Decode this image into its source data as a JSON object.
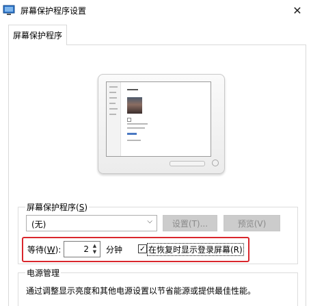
{
  "window": {
    "title": "屏幕保护程序设置",
    "close_glyph": "✕"
  },
  "tabs": [
    {
      "label": "屏幕保护程序"
    }
  ],
  "screen_saver": {
    "group_label_prefix": "屏幕保护程序(",
    "group_label_key": "S",
    "group_label_suffix": ")",
    "selected_value": "(无)",
    "settings_button": "设置(T)...",
    "preview_button": "预览(V)",
    "wait_label_prefix": "等待(",
    "wait_label_key": "W",
    "wait_label_suffix": "):",
    "wait_value": "2",
    "wait_unit": "分钟",
    "resume_checkbox_label": "在恢复时显示登录屏幕(R)",
    "resume_checked": true
  },
  "power": {
    "group_label": "电源管理",
    "description": "通过调整显示亮度和其他电源设置以节省能源或提供最佳性能。"
  },
  "colors": {
    "highlight_border": "#d9262c",
    "disabled_button_bg": "#cccccc"
  }
}
